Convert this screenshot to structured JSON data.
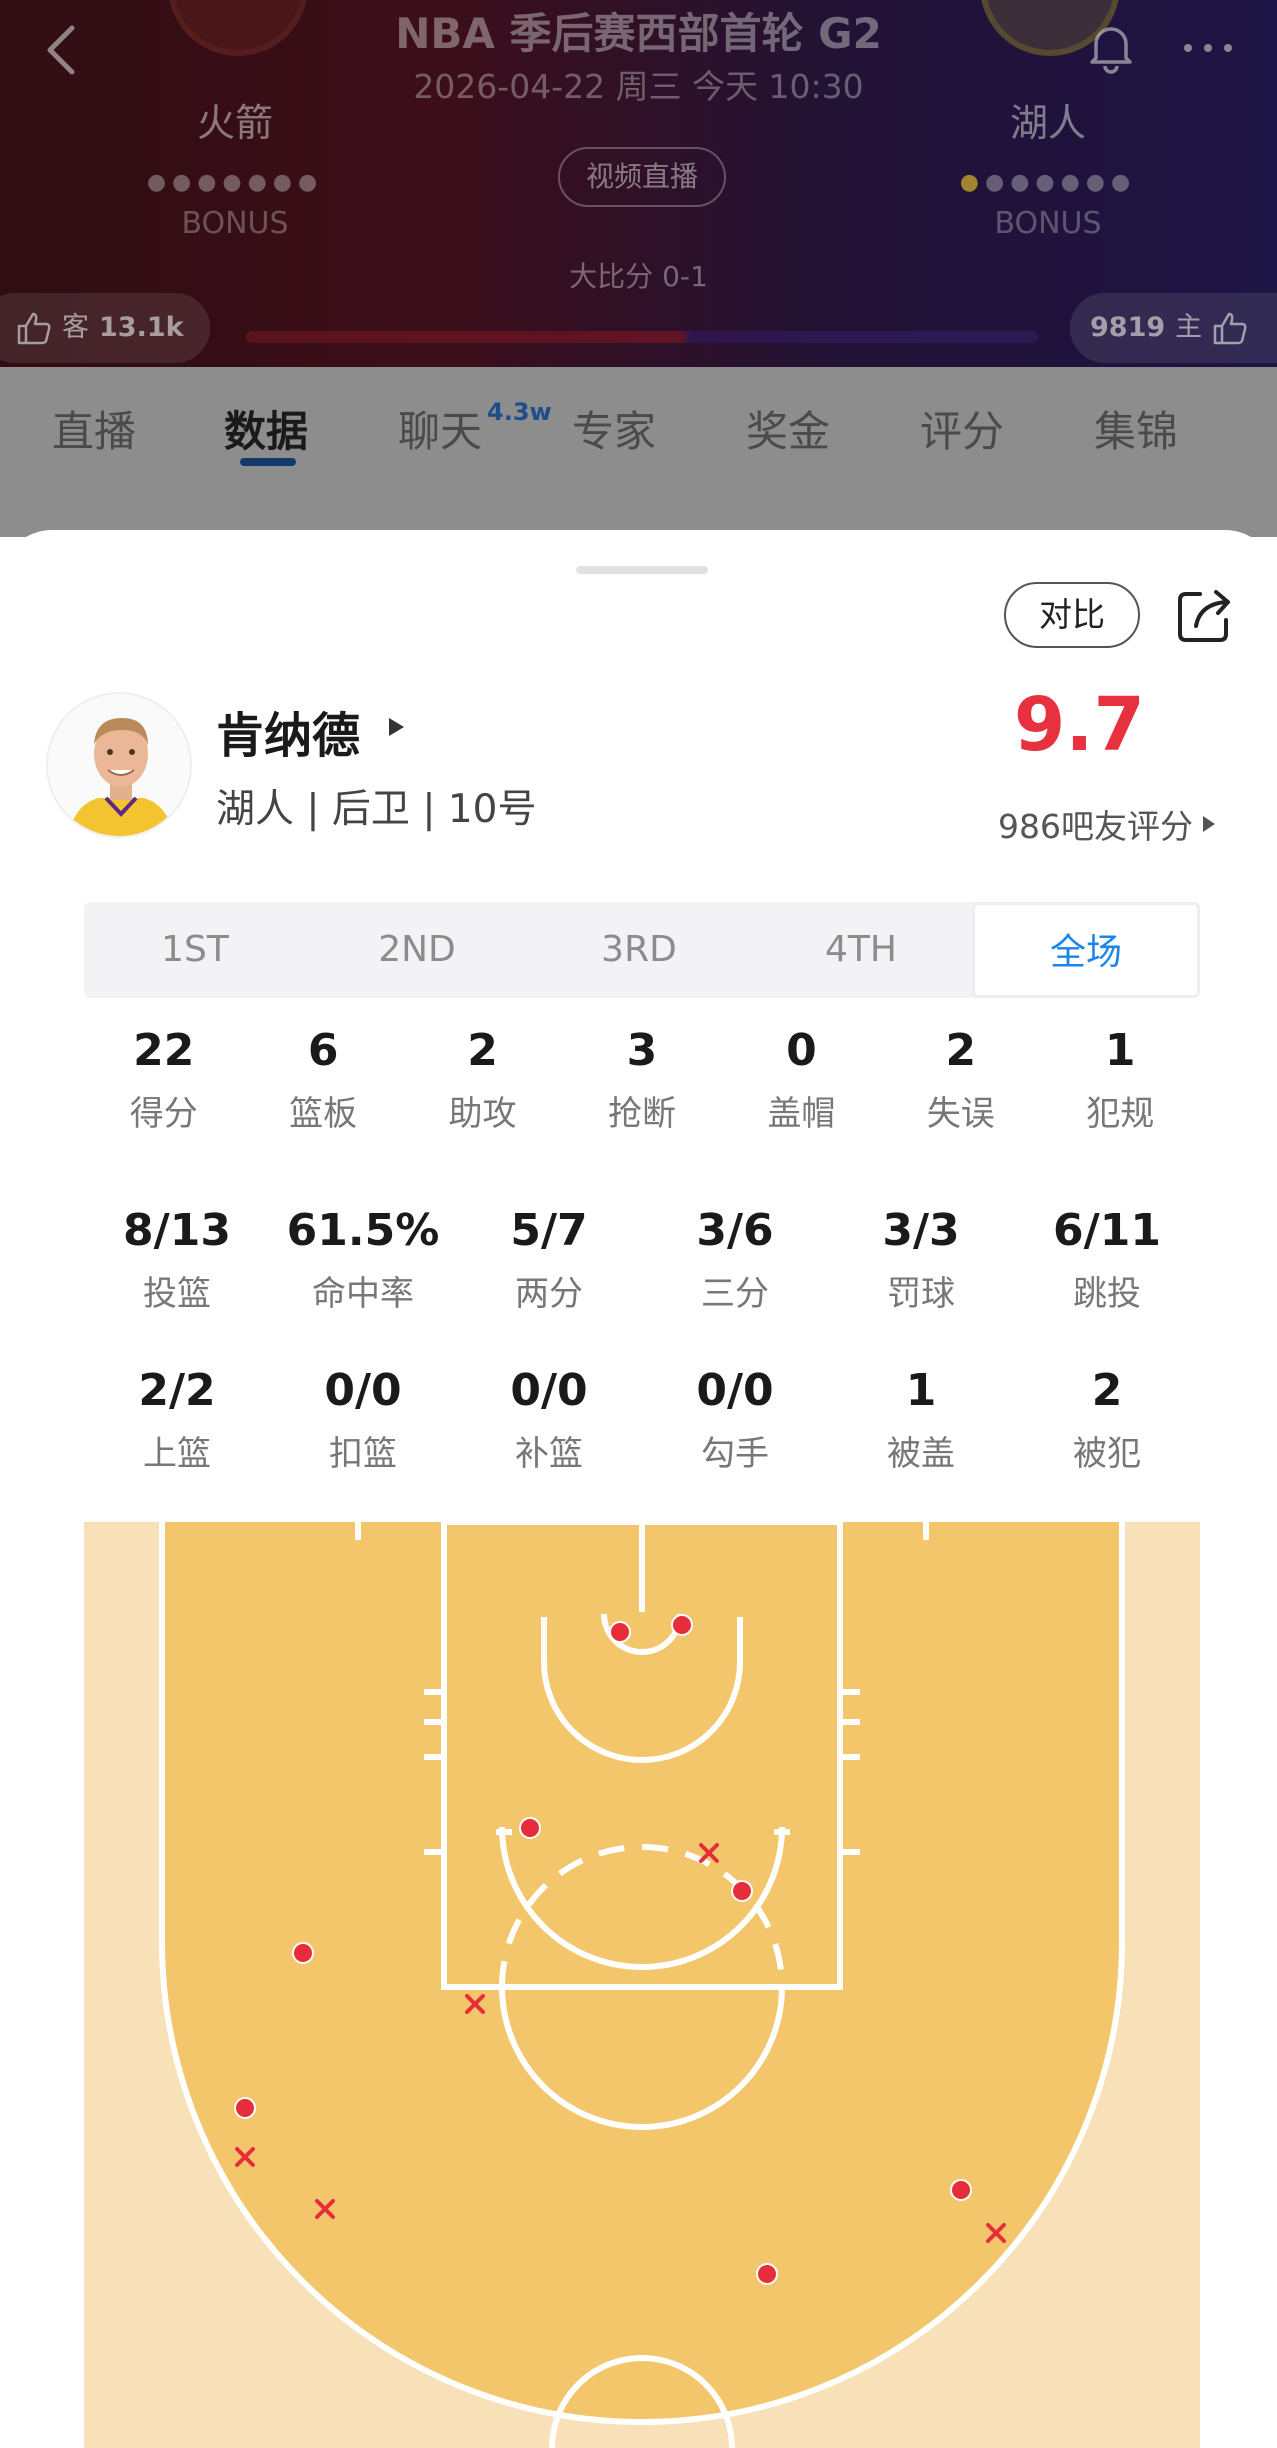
{
  "header": {
    "title": "NBA 季后赛西部首轮 G2",
    "datetime": "2026-04-22 周三 今天 10:30",
    "home_team": "火箭",
    "away_team": "湖人",
    "bonus_home": "BONUS",
    "bonus_away": "BONUS",
    "video_button": "视频直播",
    "series_score": "大比分 0-1",
    "likes_guest_label": "客",
    "likes_guest": "13.1k",
    "likes_host": "9819",
    "likes_host_label": "主",
    "colors": {
      "home": "#8b1a2c",
      "away": "#3a2270"
    }
  },
  "tabs": [
    {
      "label": "直播"
    },
    {
      "label": "数据",
      "active": true
    },
    {
      "label": "聊天",
      "badge": "4.3w"
    },
    {
      "label": "专家"
    },
    {
      "label": "奖金"
    },
    {
      "label": "评分"
    },
    {
      "label": "集锦"
    }
  ],
  "sheet": {
    "compare_button": "对比",
    "player": {
      "name": "肯纳德",
      "info": "湖人 | 后卫 | 10号",
      "rating": "9.7",
      "rating_label": "986吧友评分"
    },
    "periods": [
      {
        "label": "1ST"
      },
      {
        "label": "2ND"
      },
      {
        "label": "3RD"
      },
      {
        "label": "4TH"
      },
      {
        "label": "全场",
        "active": true
      }
    ],
    "stats_row1": [
      {
        "value": "22",
        "label": "得分"
      },
      {
        "value": "6",
        "label": "篮板"
      },
      {
        "value": "2",
        "label": "助攻"
      },
      {
        "value": "3",
        "label": "抢断"
      },
      {
        "value": "0",
        "label": "盖帽"
      },
      {
        "value": "2",
        "label": "失误"
      },
      {
        "value": "1",
        "label": "犯规"
      }
    ],
    "stats_row2": [
      {
        "value": "8/13",
        "label": "投篮"
      },
      {
        "value": "61.5%",
        "label": "命中率"
      },
      {
        "value": "5/7",
        "label": "两分"
      },
      {
        "value": "3/6",
        "label": "三分"
      },
      {
        "value": "3/3",
        "label": "罚球"
      },
      {
        "value": "6/11",
        "label": "跳投"
      }
    ],
    "stats_row3": [
      {
        "value": "2/2",
        "label": "上篮"
      },
      {
        "value": "0/0",
        "label": "扣篮"
      },
      {
        "value": "0/0",
        "label": "补篮"
      },
      {
        "value": "0/0",
        "label": "勾手"
      },
      {
        "value": "1",
        "label": "被盖"
      },
      {
        "value": "2",
        "label": "被犯"
      }
    ],
    "accent_color": "#1a86ea",
    "rating_color": "#e8313f"
  }
}
